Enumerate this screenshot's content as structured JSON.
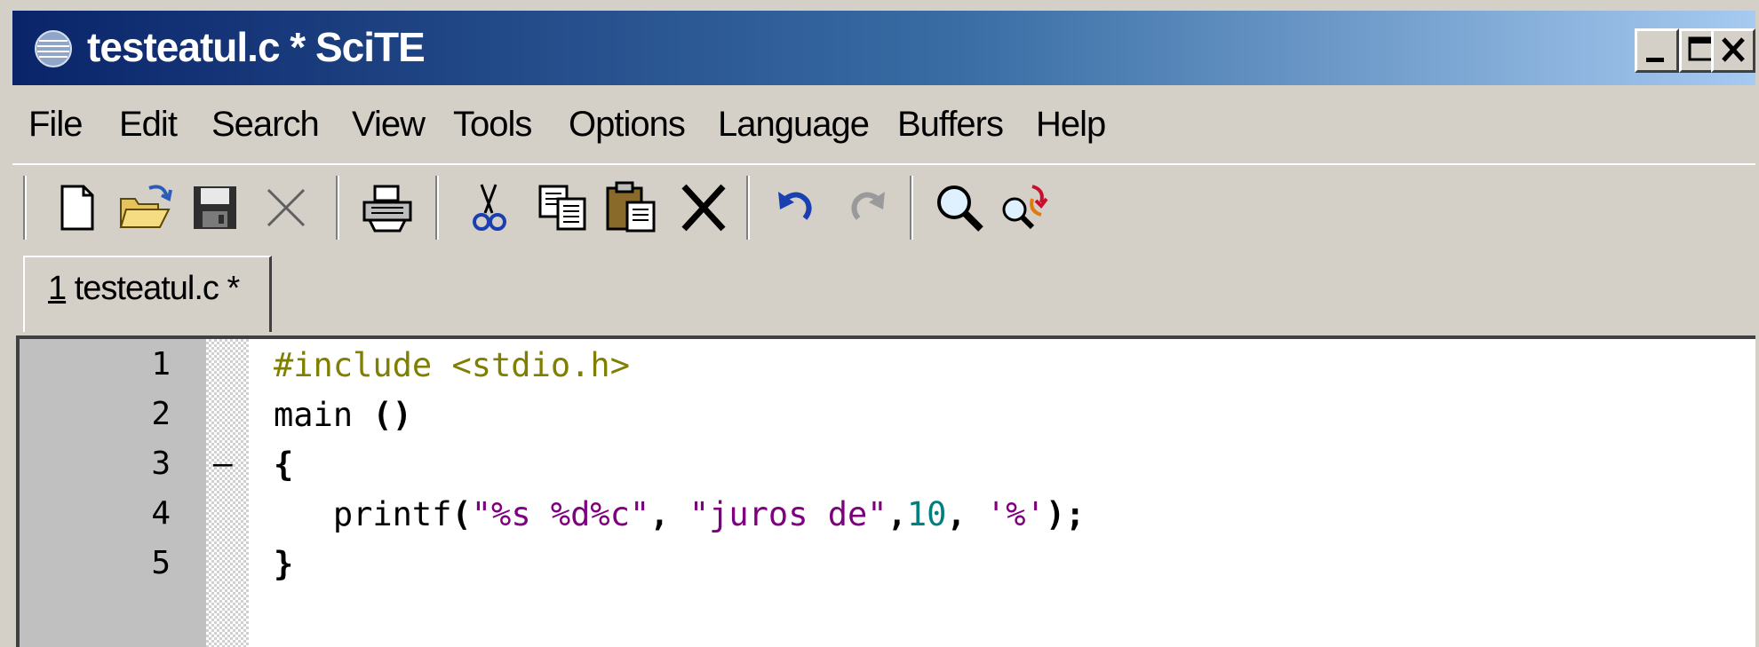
{
  "window": {
    "title": "testeatul.c * SciTE"
  },
  "menu": [
    {
      "label": "File"
    },
    {
      "label": "Edit"
    },
    {
      "label": "Search"
    },
    {
      "label": "View"
    },
    {
      "label": "Tools"
    },
    {
      "label": "Options"
    },
    {
      "label": "Language"
    },
    {
      "label": "Buffers"
    },
    {
      "label": "Help"
    }
  ],
  "toolbar": [
    {
      "icon": "new-file-icon"
    },
    {
      "icon": "open-folder-icon"
    },
    {
      "icon": "save-icon"
    },
    {
      "icon": "close-file-icon"
    },
    {
      "icon": "print-icon"
    },
    {
      "icon": "cut-icon"
    },
    {
      "icon": "copy-icon"
    },
    {
      "icon": "paste-icon"
    },
    {
      "icon": "delete-icon"
    },
    {
      "icon": "undo-icon"
    },
    {
      "icon": "redo-icon"
    },
    {
      "icon": "find-icon"
    },
    {
      "icon": "replace-icon"
    }
  ],
  "tabs": [
    {
      "number": "1",
      "label": "testeatul.c *"
    }
  ],
  "editor": {
    "line_numbers": [
      "1",
      "2",
      "3",
      "4",
      "5"
    ],
    "fold_markers": [
      "",
      "",
      "–",
      "",
      ""
    ],
    "lines": [
      {
        "tokens": [
          {
            "t": "#include <stdio.h>",
            "c": "c-pre"
          }
        ]
      },
      {
        "tokens": [
          {
            "t": "main ",
            "c": ""
          },
          {
            "t": "()",
            "c": "c-op"
          }
        ]
      },
      {
        "tokens": [
          {
            "t": "{",
            "c": "c-op"
          }
        ]
      },
      {
        "tokens": [
          {
            "t": "   printf",
            "c": ""
          },
          {
            "t": "(",
            "c": "c-op"
          },
          {
            "t": "\"%s %d%c\"",
            "c": "c-str"
          },
          {
            "t": ", ",
            "c": "c-op"
          },
          {
            "t": "\"juros de\"",
            "c": "c-str"
          },
          {
            "t": ",",
            "c": "c-op"
          },
          {
            "t": "10",
            "c": "c-num"
          },
          {
            "t": ", ",
            "c": "c-op"
          },
          {
            "t": "'%'",
            "c": "c-chr"
          },
          {
            "t": ");",
            "c": "c-op"
          }
        ]
      },
      {
        "tokens": [
          {
            "t": "}",
            "c": "c-op"
          }
        ]
      }
    ]
  },
  "colors": {
    "title_active": "#0a246a",
    "preprocessor": "#7f7f00",
    "string": "#7f007f",
    "number": "#007f7f"
  }
}
